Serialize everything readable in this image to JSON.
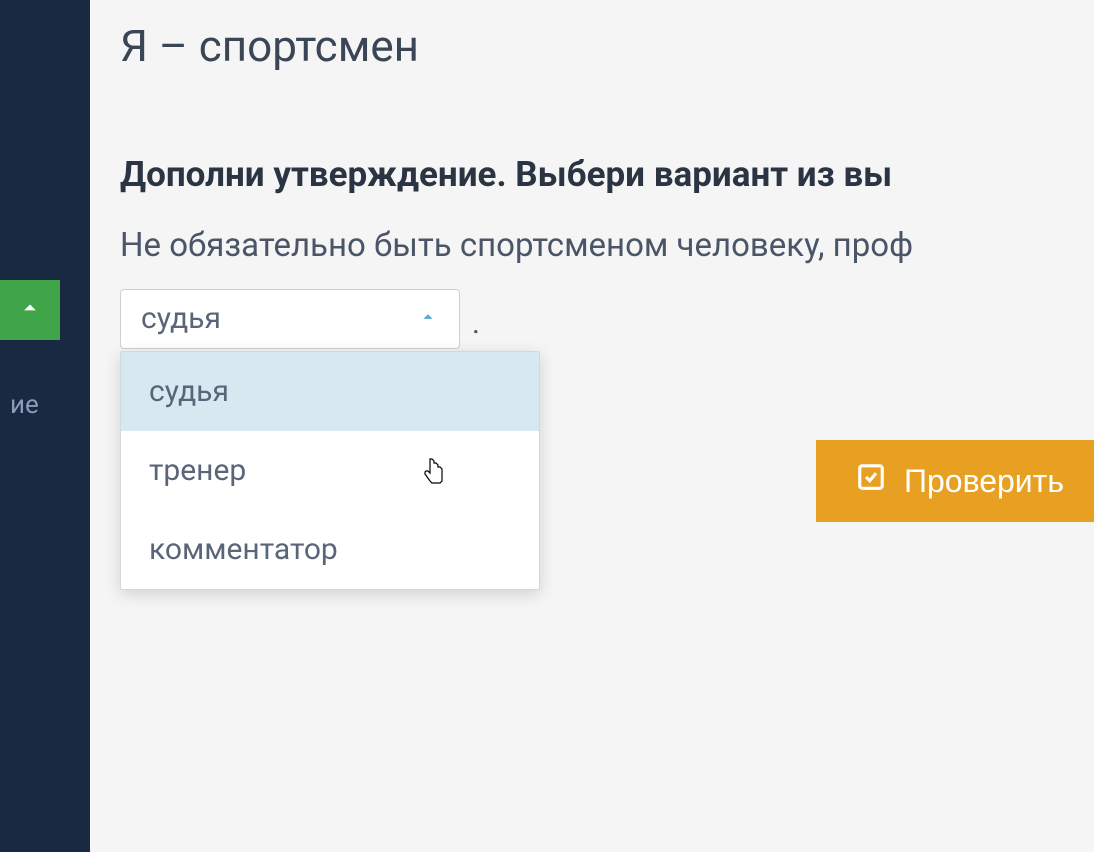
{
  "sidebar": {
    "partial_text": "ие"
  },
  "page": {
    "title": "Я – спортсмен"
  },
  "task": {
    "instruction": "Дополни утверждение. Выбери вариант из вы",
    "question": "Не обязательно быть спортсменом человеку, проф",
    "period": "."
  },
  "dropdown": {
    "selected": "судья",
    "options": [
      "судья",
      "тренер",
      "комментатор"
    ]
  },
  "button": {
    "check_label": "Проверить"
  }
}
